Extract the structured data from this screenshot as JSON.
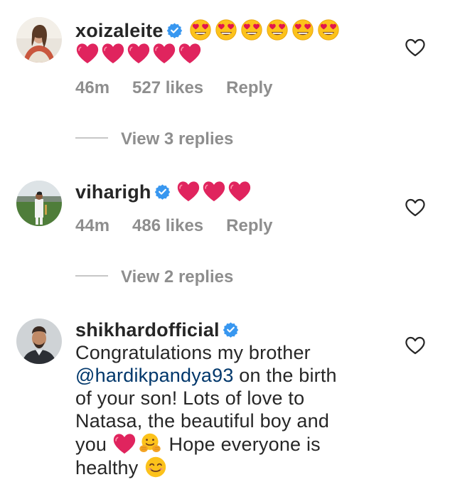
{
  "comments": [
    {
      "username": "xoizaleite",
      "verified": true,
      "emojis_line1": [
        "heart-eyes",
        "heart-eyes",
        "heart-eyes",
        "heart-eyes",
        "heart-eyes",
        "heart-eyes"
      ],
      "emojis_line2": [
        "red-heart",
        "red-heart",
        "red-heart",
        "red-heart",
        "red-heart"
      ],
      "time": "46m",
      "likes": "527 likes",
      "reply": "Reply",
      "view_replies": "View 3 replies"
    },
    {
      "username": "viharigh",
      "verified": true,
      "emojis_line1": [
        "red-heart",
        "red-heart",
        "red-heart"
      ],
      "time": "44m",
      "likes": "486 likes",
      "reply": "Reply",
      "view_replies": "View 2 replies"
    },
    {
      "username": "shikhardofficial",
      "verified": true,
      "text_1": "Congratulations my brother",
      "mention": "@hardikpandya93",
      "text_2": " on the birth",
      "text_3": "of your son! Lots of love to",
      "text_4": "Natasa, the beautiful boy and",
      "text_5a": "you",
      "text_5b": "Hope everyone is",
      "text_6": "healthy"
    }
  ],
  "colors": {
    "text": "#262626",
    "meta": "#8e8e8e",
    "mention": "#00376b",
    "verified": "#3897f0",
    "heart": "#e0245e"
  }
}
